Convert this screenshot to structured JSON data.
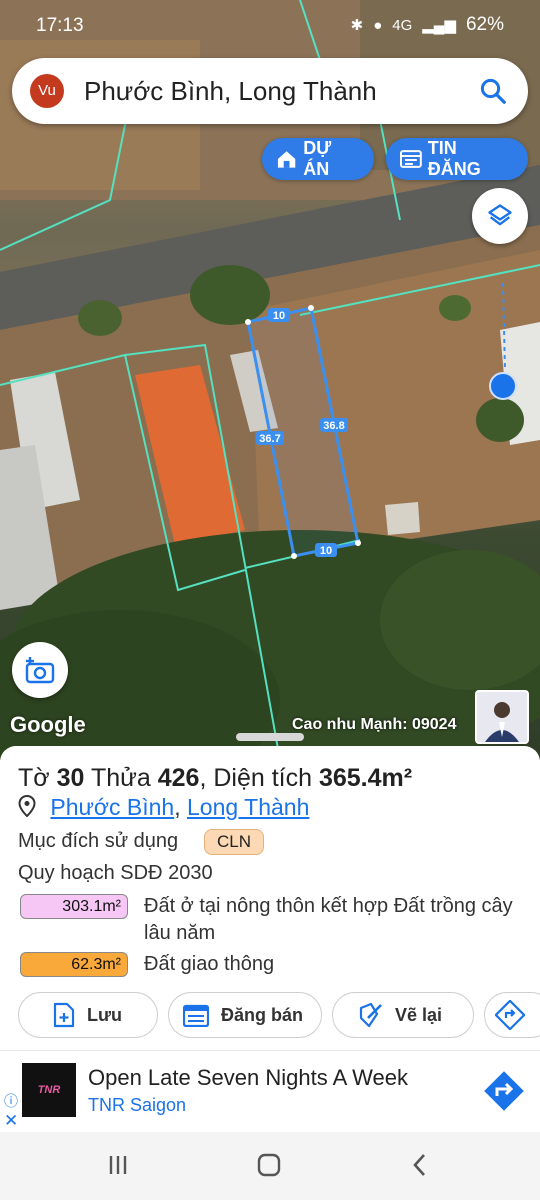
{
  "status_bar": {
    "time": "17:13",
    "network": "4G",
    "battery": "62%"
  },
  "search": {
    "avatar_text": "Vu",
    "location": "Phước Bình, Long Thành"
  },
  "map_buttons": {
    "project_label": "DỰ ÁN",
    "listing_label": "TIN ĐĂNG"
  },
  "map": {
    "edge_top": "10",
    "edge_right": "36.8",
    "edge_left": "36.7",
    "edge_bottom": "10",
    "google_text": "Google",
    "contact_text": "Cao nhu Mạnh: 09024"
  },
  "parcel": {
    "sheet_label": "Tờ",
    "sheet_number": "30",
    "lot_label": "Thửa",
    "lot_number": "426",
    "area_label": "Diện tích",
    "area_value": "365.4m²",
    "ward": "Phước Bình",
    "district": "Long Thành",
    "purpose_label": "Mục đích sử dụng",
    "purpose_code": "CLN",
    "plan_label": "Quy hoạch SDĐ 2030",
    "zones": [
      {
        "area": "303.1m²",
        "description": "Đất ở tại nông thôn kết hợp Đất trồng cây lâu năm",
        "color": "#f6c6f5"
      },
      {
        "area": "62.3m²",
        "description": "Đất giao thông",
        "color": "#f9a93a"
      }
    ]
  },
  "actions": {
    "save": "Lưu",
    "sell": "Đăng bán",
    "redraw": "Vẽ lại"
  },
  "ad": {
    "logo_text": "TNR Saigon",
    "headline": "Open Late Seven Nights A Week",
    "brand": "TNR Saigon"
  },
  "colors": {
    "accent": "#2f7be8",
    "parcel_outline": "#3a8ff0",
    "cadastral_line": "#55e0c0"
  }
}
